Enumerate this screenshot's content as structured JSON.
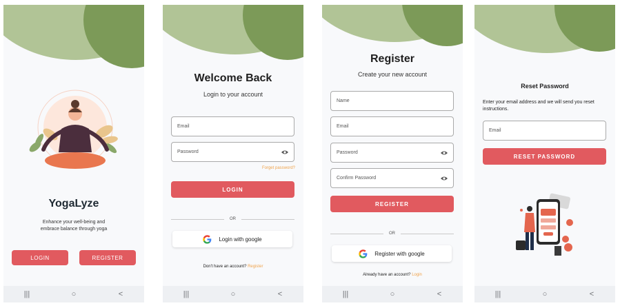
{
  "welcome": {
    "app_name": "YogaLyze",
    "tagline_line1": "Enhance your well-being and",
    "tagline_line2": "embrace balance through yoga",
    "login_label": "LOGIN",
    "register_label": "REGISTER"
  },
  "login": {
    "title": "Welcome Back",
    "subtitle": "Login to your account",
    "email_placeholder": "Email",
    "password_placeholder": "Password",
    "forgot_label": "Forget password?",
    "login_button": "LOGIN",
    "or_label": "OR",
    "google_label": "Login with google",
    "no_account_text": "Don't have an account?",
    "register_link": "Register"
  },
  "register": {
    "title": "Register",
    "subtitle": "Create your new account",
    "name_placeholder": "Name",
    "email_placeholder": "Email",
    "password_placeholder": "Password",
    "confirm_placeholder": "Confirm Password",
    "register_button": "REGISTER",
    "or_label": "OR",
    "google_label": "Register with google",
    "have_account_text": "Already have an account?",
    "login_link": "Login"
  },
  "reset": {
    "title": "Reset Password",
    "description": "Enter your email address and we will send you reset instructions.",
    "email_placeholder": "Email",
    "reset_button": "RESET PASSWORD"
  },
  "navbar": {
    "recents_icon": "|||",
    "home_icon": "○",
    "back_icon": "<"
  },
  "colors": {
    "accent": "#e15a5f",
    "header_light": "#b1c496",
    "header_dark": "#7c9a58",
    "link": "#f0a34b"
  }
}
